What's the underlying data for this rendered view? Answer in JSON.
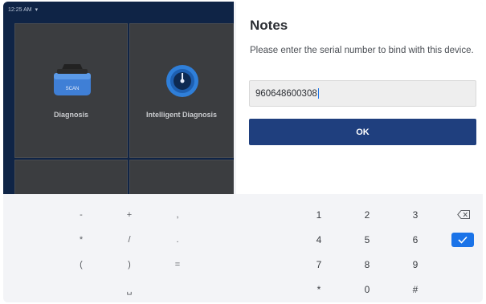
{
  "status_bar": {
    "time": "12:25 AM"
  },
  "app": {
    "tiles": [
      {
        "label": "Diagnosis",
        "icon": "car-scan-icon",
        "badge": "SCAN"
      },
      {
        "label": "Intelligent Diagnosis",
        "icon": "gauge-icon"
      }
    ]
  },
  "dialog": {
    "title": "Notes",
    "message": "Please enter the serial number to bind with this device.",
    "serial_value": "960648600308",
    "ok_label": "OK"
  },
  "keyboard": {
    "symbols": [
      [
        "-",
        "+",
        ","
      ],
      [
        "*",
        "/",
        "."
      ],
      [
        "(",
        ")",
        "="
      ],
      [
        "",
        "␣",
        ""
      ]
    ],
    "digits": [
      [
        "1",
        "2",
        "3"
      ],
      [
        "4",
        "5",
        "6"
      ],
      [
        "7",
        "8",
        "9"
      ],
      [
        "*",
        "0",
        "#"
      ]
    ],
    "backspace_icon": "backspace-icon",
    "enter_icon": "checkmark-icon"
  },
  "colors": {
    "primary_button": "#1f3f7e",
    "enter_key": "#1a73e8",
    "app_background": "#0f2446"
  }
}
